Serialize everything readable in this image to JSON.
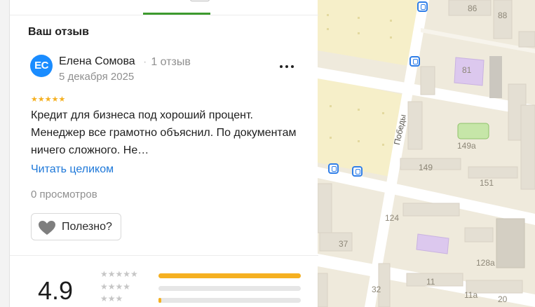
{
  "review_section": {
    "title": "Ваш отзыв"
  },
  "review": {
    "avatar_initials": "ЕС",
    "author": "Елена Сомова",
    "author_reviews": "1 отзыв",
    "date": "5 декабря 2025",
    "rating_stars": "★★★★★",
    "text": "Кредит для бизнеса под хороший процент. Менеджер все грамотно объяснил. По документам ничего сложного. Не…",
    "read_more": "Читать целиком",
    "views": "0 просмотров",
    "useful_label": "Полезно?",
    "more_icon": "more-dots-icon",
    "useful_icon": "heart-icon"
  },
  "rating_summary": {
    "average": "4.9",
    "distribution": [
      {
        "stars": "★★★★★",
        "fraction": 1.0
      },
      {
        "stars": "★★★★",
        "fraction": 0.0
      },
      {
        "stars": "★★★",
        "fraction": 0.02
      }
    ]
  },
  "map": {
    "street_name": "Победы",
    "house_numbers": [
      "86",
      "88",
      "81",
      "149а",
      "149",
      "151",
      "124",
      "37",
      "128а",
      "11",
      "32",
      "11а",
      "20"
    ],
    "bus_stop_icon": "bus-stop-icon",
    "colors": {
      "background": "#efeadc",
      "block": "#f6efc9",
      "road": "#ffffff",
      "building": "#e4dfd3",
      "school": "#dcc8ee",
      "park": "#c6e6a8",
      "accent_star": "#f5b021",
      "link": "#1e78d9",
      "tab_active": "#3d9a2e"
    }
  }
}
